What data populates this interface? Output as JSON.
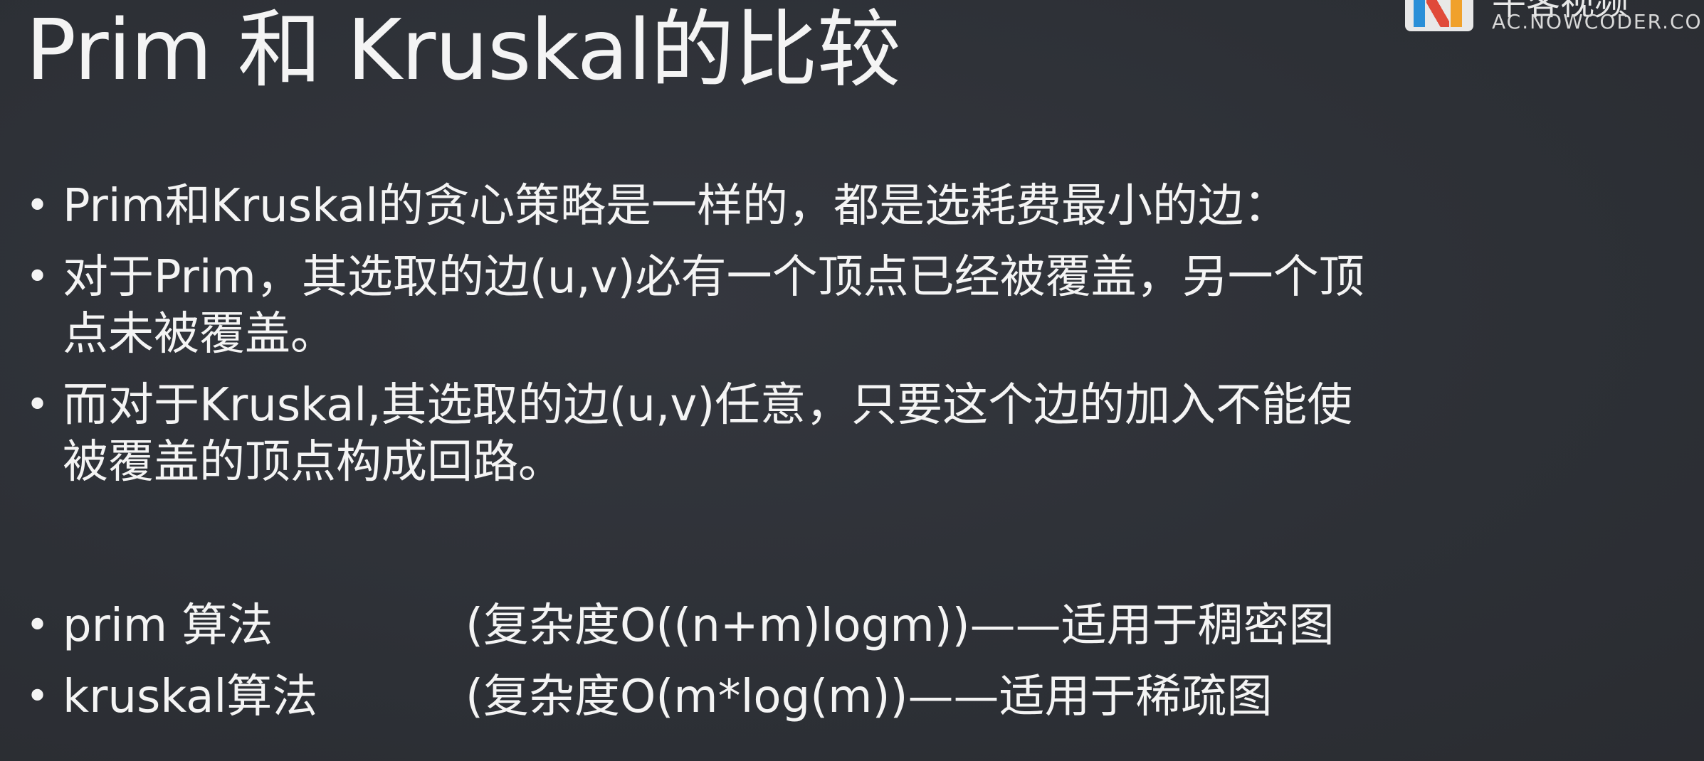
{
  "slide": {
    "title": "Prim 和 Kruskal的比较",
    "logo": {
      "cn_text": "牛客视频",
      "url_text": "AC.NOWCODER.COM"
    },
    "bullet_char": "•",
    "bullets": [
      {
        "lines": [
          "Prim和Kruskal的贪心策略是一样的，都是选耗费最小的边："
        ]
      },
      {
        "lines": [
          "对于Prim，其选取的边(u,v)必有一个顶点已经被覆盖，另一个顶",
          "点未被覆盖。"
        ]
      },
      {
        "lines": [
          "而对于Kruskal,其选取的边(u,v)任意，只要这个边的加入不能使",
          "被覆盖的顶点构成回路。"
        ]
      }
    ],
    "algorithms": [
      {
        "name": "prim 算法",
        "desc": "(复杂度O((n+m)logm))——适用于稠密图"
      },
      {
        "name": "kruskal算法",
        "desc": "(复杂度O(m*log(m))——适用于稀疏图"
      }
    ]
  },
  "colors": {
    "background": "#2e3138",
    "text": "#f4f4f4"
  }
}
